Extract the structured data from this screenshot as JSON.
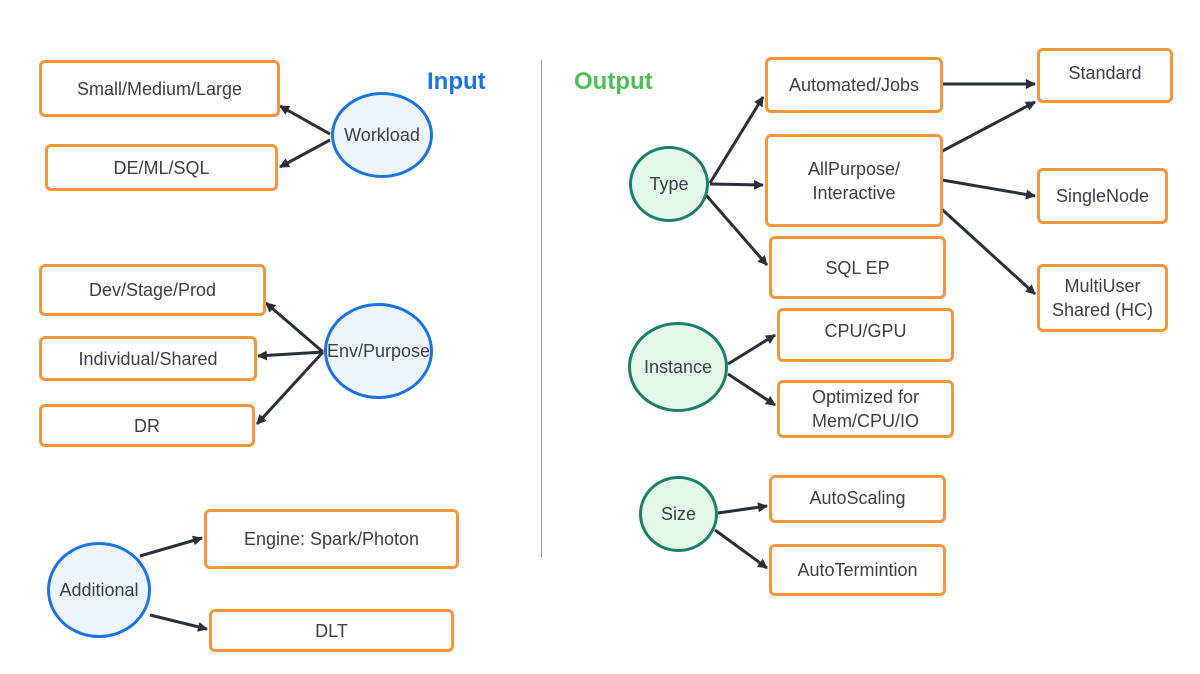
{
  "sections": {
    "input": {
      "label": "Input",
      "color": "#1a73e8"
    },
    "output": {
      "label": "Output",
      "color": "#4cbf55"
    }
  },
  "input_nodes": {
    "workload": {
      "label": "Workload",
      "children": [
        "Small/Medium/Large",
        "DE/ML/SQL"
      ]
    },
    "env_purpose": {
      "label": "Env/Purpose",
      "children": [
        "Dev/Stage/Prod",
        "Individual/Shared",
        "DR"
      ]
    },
    "additional": {
      "label": "Additional",
      "children": [
        "Engine: Spark/Photon",
        "DLT"
      ]
    }
  },
  "output_nodes": {
    "type": {
      "label": "Type",
      "children": [
        "Automated/Jobs",
        "AllPurpose/ Interactive",
        "SQL EP"
      ]
    },
    "instance": {
      "label": "Instance",
      "children": [
        "CPU/GPU",
        "Optimized for Mem/CPU/IO"
      ]
    },
    "size": {
      "label": "Size",
      "children": [
        "AutoScaling",
        "AutoTermintion"
      ]
    }
  },
  "modes": [
    "Standard",
    "SingleNode",
    "MultiUser Shared (HC)"
  ],
  "edges": [
    {
      "from": "Workload",
      "to": "Small/Medium/Large"
    },
    {
      "from": "Workload",
      "to": "DE/ML/SQL"
    },
    {
      "from": "Env/Purpose",
      "to": "Dev/Stage/Prod"
    },
    {
      "from": "Env/Purpose",
      "to": "Individual/Shared"
    },
    {
      "from": "Env/Purpose",
      "to": "DR"
    },
    {
      "from": "Additional",
      "to": "Engine: Spark/Photon"
    },
    {
      "from": "Additional",
      "to": "DLT"
    },
    {
      "from": "Type",
      "to": "Automated/Jobs"
    },
    {
      "from": "Type",
      "to": "AllPurpose/ Interactive"
    },
    {
      "from": "Type",
      "to": "SQL EP"
    },
    {
      "from": "Automated/Jobs",
      "to": "Standard"
    },
    {
      "from": "AllPurpose/ Interactive",
      "to": "Standard"
    },
    {
      "from": "AllPurpose/ Interactive",
      "to": "SingleNode"
    },
    {
      "from": "AllPurpose/ Interactive",
      "to": "MultiUser Shared (HC)"
    },
    {
      "from": "Instance",
      "to": "CPU/GPU"
    },
    {
      "from": "Instance",
      "to": "Optimized for Mem/CPU/IO"
    },
    {
      "from": "Size",
      "to": "AutoScaling"
    },
    {
      "from": "Size",
      "to": "AutoTermintion"
    }
  ]
}
